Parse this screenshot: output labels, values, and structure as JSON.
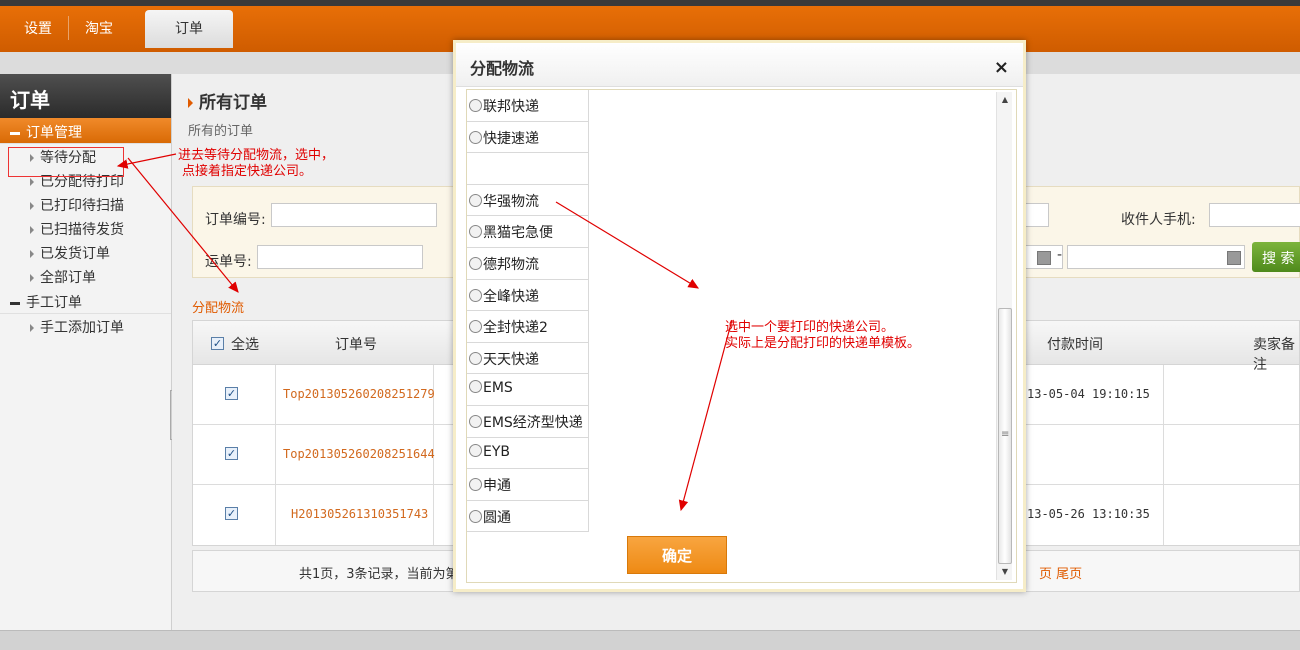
{
  "topnav": {
    "items": [
      "设置",
      "淘宝"
    ],
    "active": "订单"
  },
  "sidebar": {
    "title": "订单",
    "group1": "订单管理",
    "group1_items": [
      "等待分配",
      "已分配待打印",
      "已打印待扫描",
      "已扫描待发货",
      "已发货订单",
      "全部订单"
    ],
    "group2": "手工订单",
    "group2_items": [
      "手工添加订单"
    ]
  },
  "main": {
    "title": "所有订单",
    "subtitle": "所有的订单",
    "filter": {
      "order_no_label": "订单编号:",
      "waybill_label": "运单号:",
      "phone_label": "收件人手机:",
      "date_dash": "-",
      "search_label": "搜 索"
    },
    "assign_link": "分配物流",
    "table": {
      "headers": [
        "全选",
        "订单号",
        "付款时间",
        "卖家备注"
      ],
      "rows": [
        {
          "order_no": "Top201305260208251279",
          "pay_time": "13-05-04 19:10:15"
        },
        {
          "order_no": "Top201305260208251644",
          "pay_time": ""
        },
        {
          "order_no": "H201305261310351743",
          "pay_time": "13-05-26 13:10:35"
        }
      ]
    },
    "pager": {
      "text": "共1页，3条记录，当前为第",
      "last_links": "页 尾页"
    }
  },
  "modal": {
    "title": "分配物流",
    "close": "×",
    "carriers": [
      "联邦快递",
      "快捷速递",
      "",
      "华强物流",
      "黑猫宅急便",
      "德邦物流",
      "全峰快递",
      "全封快递2",
      "天天快递",
      "EMS",
      "EMS经济型快递",
      "EYB",
      "申通",
      "圆通"
    ],
    "confirm": "确定"
  },
  "annotations": {
    "sidebar_note_line1": "进去等待分配物流，选中，",
    "sidebar_note_line2": "点接着指定快递公司。",
    "modal_note_line1": "选中一个要打印的快递公司。",
    "modal_note_line2": "实际上是分配打印的快递单模板。"
  },
  "colors": {
    "accent": "#e86f07",
    "link": "#e05b00",
    "annotation": "#e00000",
    "confirm": "#f39a2a"
  }
}
